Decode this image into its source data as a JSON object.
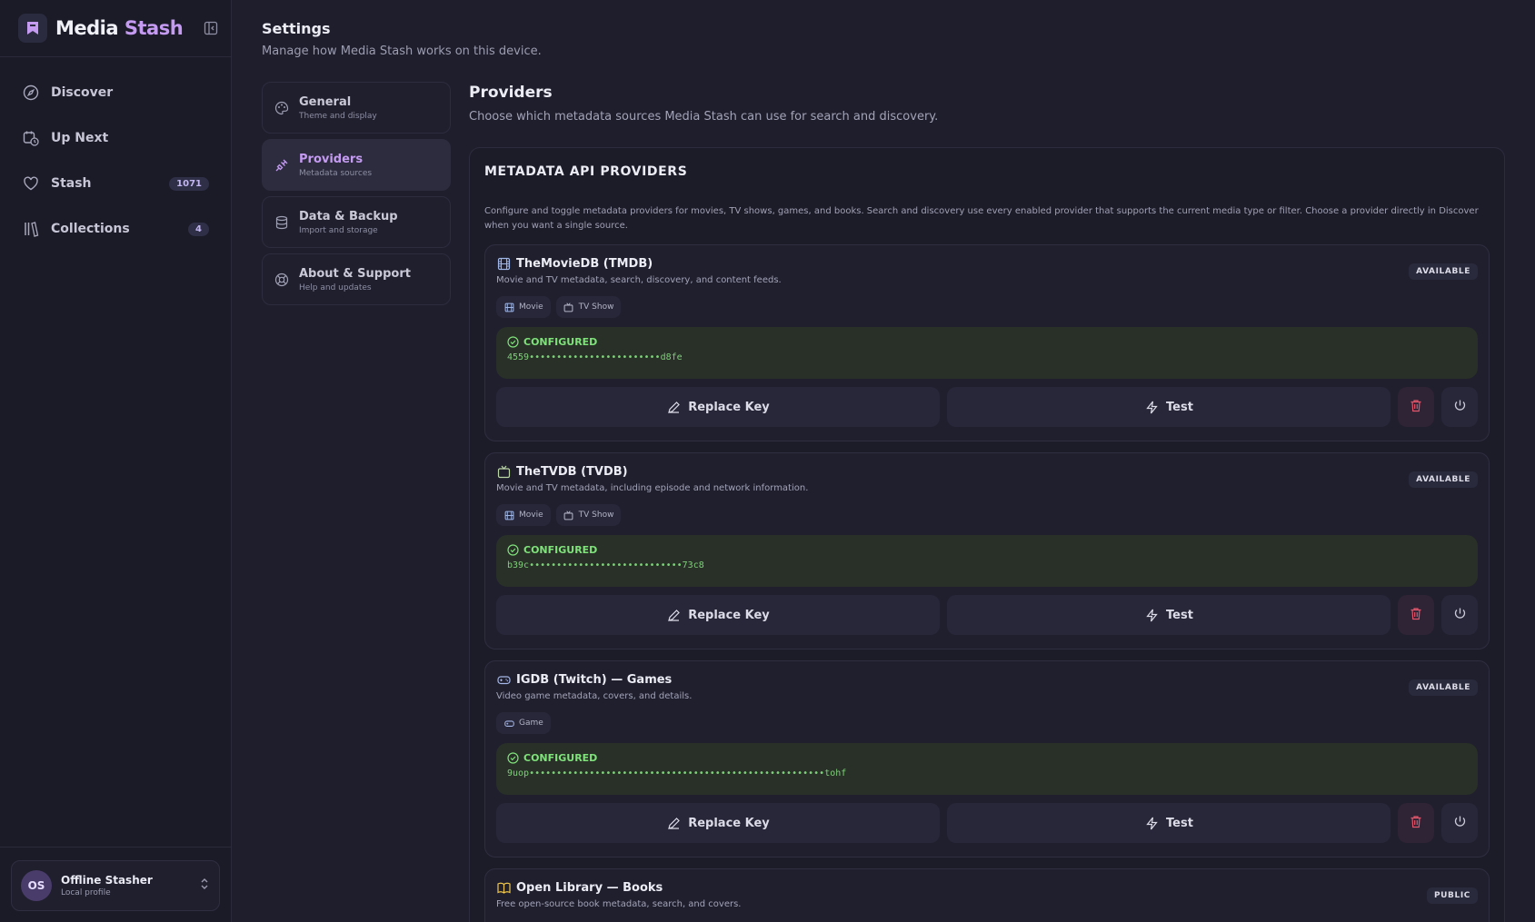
{
  "app": {
    "name_main": "Media",
    "name_accent": "Stash"
  },
  "sidebar": {
    "items": [
      {
        "label": "Discover",
        "icon": "compass-icon"
      },
      {
        "label": "Up Next",
        "icon": "calendar-clock-icon"
      },
      {
        "label": "Stash",
        "icon": "heart-icon",
        "count": "1071"
      },
      {
        "label": "Collections",
        "icon": "library-icon",
        "count": "4"
      }
    ],
    "profile": {
      "initials": "OS",
      "name": "Offline Stasher",
      "sub": "Local profile"
    }
  },
  "settings": {
    "title": "Settings",
    "subtitle": "Manage how Media Stash works on this device.",
    "nav": [
      {
        "label": "General",
        "desc": "Theme and display",
        "icon": "palette-icon"
      },
      {
        "label": "Providers",
        "desc": "Metadata sources",
        "icon": "plug-icon",
        "active": true
      },
      {
        "label": "Data & Backup",
        "desc": "Import and storage",
        "icon": "database-icon"
      },
      {
        "label": "About & Support",
        "desc": "Help and updates",
        "icon": "lifebuoy-icon"
      }
    ]
  },
  "main": {
    "title": "Providers",
    "subtitle": "Choose which metadata sources Media Stash can use for search and discovery.",
    "panel_title": "METADATA API PROVIDERS",
    "panel_desc": "Configure and toggle metadata providers for movies, TV shows, games, and books. Search and discovery use every enabled provider that supports the current media type or filter. Choose a provider directly in Discover when you want a single source.",
    "providers": [
      {
        "name": "TheMovieDB (TMDB)",
        "icon": "film-icon",
        "badge": "AVAILABLE",
        "desc": "Movie and TV metadata, search, discovery, and content feeds.",
        "tags": [
          "Movie",
          "TV Show"
        ],
        "status": "CONFIGURED",
        "key": "4559••••••••••••••••••••••••d8fe",
        "replace_label": "Replace Key",
        "test_label": "Test"
      },
      {
        "name": "TheTVDB (TVDB)",
        "icon": "tv-icon",
        "badge": "AVAILABLE",
        "desc": "Movie and TV metadata, including episode and network information.",
        "tags": [
          "Movie",
          "TV Show"
        ],
        "status": "CONFIGURED",
        "key": "b39c••••••••••••••••••••••••••••73c8",
        "replace_label": "Replace Key",
        "test_label": "Test"
      },
      {
        "name": "IGDB (Twitch) — Games",
        "icon": "gamepad-icon",
        "badge": "AVAILABLE",
        "desc": "Video game metadata, covers, and details.",
        "tags": [
          "Game"
        ],
        "status": "CONFIGURED",
        "key": "9uop••••••••••••••••••••••••••••••••••••••••••••••••••••••tohf",
        "replace_label": "Replace Key",
        "test_label": "Test"
      },
      {
        "name": "Open Library — Books",
        "icon": "book-icon",
        "badge": "PUBLIC",
        "desc": "Free open-source book metadata, search, and covers."
      }
    ]
  },
  "colors": {
    "accent": "#c59bf2",
    "configured": "#7fe27a",
    "danger": "#e0566a"
  }
}
